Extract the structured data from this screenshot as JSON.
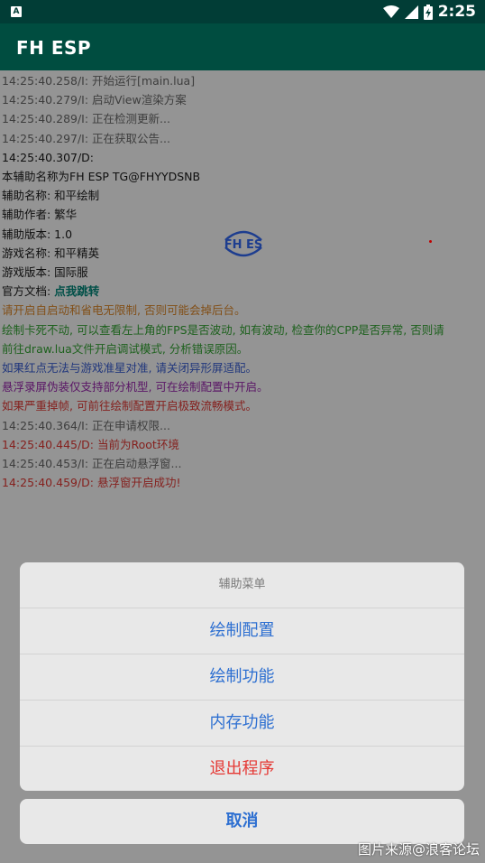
{
  "status_bar": {
    "time": "2:25",
    "notification_icon": "android-a-icon",
    "icons": [
      "wifi-icon",
      "signal-icon",
      "battery-charging-icon"
    ]
  },
  "app_bar": {
    "title": "FH ESP"
  },
  "log_lines": [
    {
      "text": "14:25:40.258/I: 开始运行[main.lua]",
      "color": "#6b6b6b"
    },
    {
      "text": "14:25:40.279/I: 启动View渲染方案",
      "color": "#6b6b6b"
    },
    {
      "text": "14:25:40.289/I: 正在检测更新...",
      "color": "#6b6b6b"
    },
    {
      "text": "14:25:40.297/I: 正在获取公告...",
      "color": "#6b6b6b"
    },
    {
      "text": "14:25:40.307/D:",
      "color": "#1a1a1a"
    },
    {
      "text": "本辅助名称为FH ESP TG@FHYYDSNB",
      "color": "#1a1a1a"
    },
    {
      "text": "辅助名称: 和平绘制",
      "color": "#1a1a1a"
    },
    {
      "text": "辅助作者: 繁华",
      "color": "#1a1a1a"
    },
    {
      "text": "辅助版本: 1.0",
      "color": "#1a1a1a"
    },
    {
      "text": "游戏名称: 和平精英",
      "color": "#1a1a1a"
    },
    {
      "text": "游戏版本: 国际服",
      "color": "#1a1a1a"
    },
    {
      "text": "请开启自启动和省电无限制, 否则可能会掉后台。",
      "color": "#e08a2c"
    },
    {
      "text": "绘制卡死不动, 可以查看左上角的FPS是否波动, 如有波动, 检查你的CPP是否异常, 否则请",
      "color": "#35a835"
    },
    {
      "text": "前往draw.lua文件开启调试模式, 分析错误原因。",
      "color": "#35a835"
    },
    {
      "text": "如果红点无法与游戏准星对准, 请关闭异形屏适配。",
      "color": "#3a5fd6"
    },
    {
      "text": "悬浮录屏伪装仅支持部分机型, 可在绘制配置中开启。",
      "color": "#9c27b0"
    },
    {
      "text": "如果严重掉帧, 可前往绘制配置开启极致流畅模式。",
      "color": "#e53935"
    },
    {
      "text": "14:25:40.364/I: 正在申请权限...",
      "color": "#6b6b6b"
    },
    {
      "text": "14:25:40.445/D: 当前为Root环境",
      "color": "#e53935"
    },
    {
      "text": "14:25:40.453/I: 正在启动悬浮窗...",
      "color": "#6b6b6b"
    },
    {
      "text": "14:25:40.459/D: 悬浮窗开启成功!",
      "color": "#e53935"
    }
  ],
  "docs_line": {
    "label": "官方文档: ",
    "link": "点我跳转",
    "link_color": "#00897b"
  },
  "logo_text": "FH ES",
  "menu": {
    "title": "辅助菜单",
    "items": [
      {
        "label": "绘制配置",
        "style": "normal"
      },
      {
        "label": "绘制功能",
        "style": "normal"
      },
      {
        "label": "内存功能",
        "style": "normal"
      },
      {
        "label": "退出程序",
        "style": "danger"
      }
    ],
    "cancel_label": "取消"
  },
  "watermark": "图片来源@浪客论坛",
  "colors": {
    "app_bar": "#004d40",
    "status_bar": "#013d36",
    "menu_text": "#2d6fd1",
    "danger_text": "#e53935"
  }
}
